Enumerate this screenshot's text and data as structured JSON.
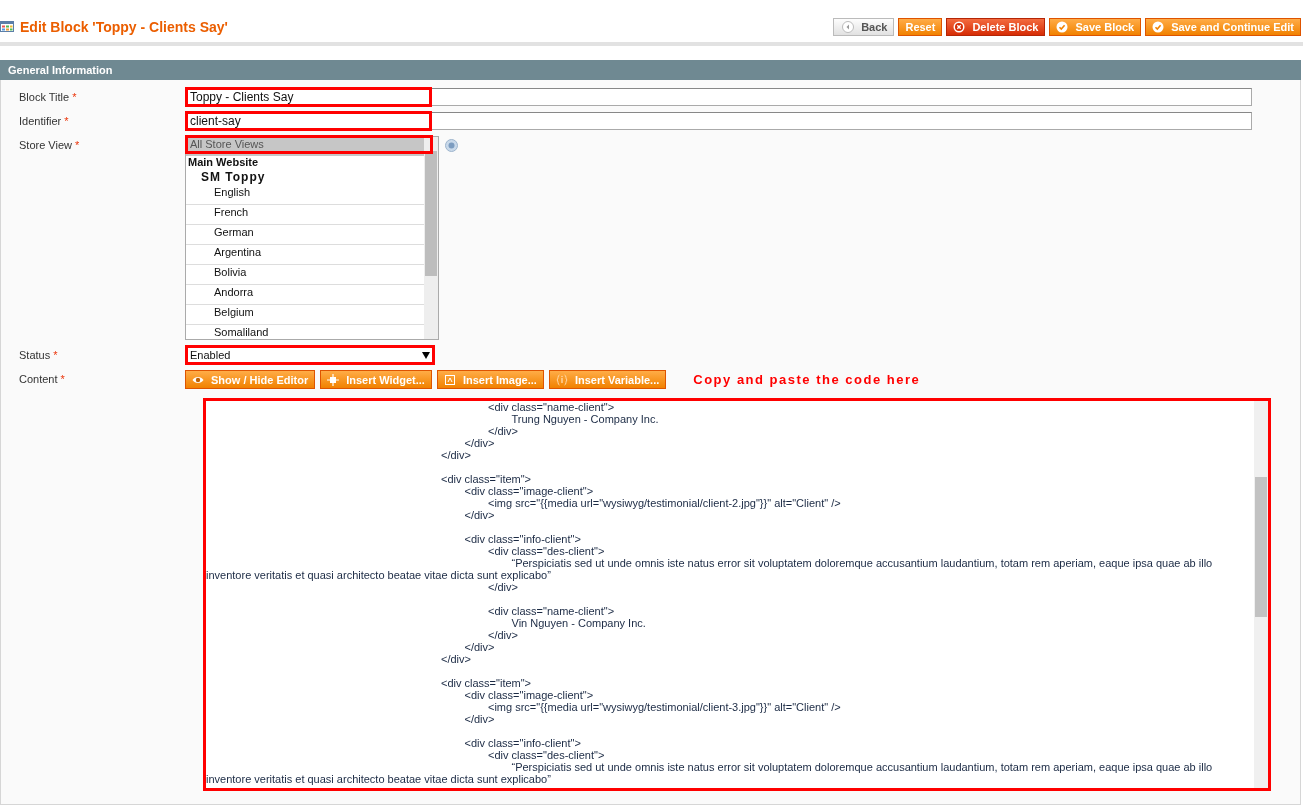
{
  "page_title": "Edit Block 'Toppy - Clients Say'",
  "buttons": [
    {
      "label": "Back",
      "kind": "back"
    },
    {
      "label": "Reset",
      "kind": "plain"
    },
    {
      "label": "Delete Block",
      "kind": "delete"
    },
    {
      "label": "Save Block",
      "kind": "save"
    },
    {
      "label": "Save and Continue Edit",
      "kind": "save"
    }
  ],
  "section": {
    "title": "General Information",
    "fields": [
      {
        "kind": "text",
        "label": "Block Title",
        "required": "*",
        "value": "Toppy - Clients Say",
        "highlighted": true
      },
      {
        "kind": "text",
        "label": "Identifier",
        "required": "*",
        "value": "client-say",
        "highlighted": true
      },
      {
        "kind": "multiselect",
        "label": "Store View",
        "required": "*",
        "highlighted": true,
        "options": [
          {
            "label": "All Store Views",
            "selected": true
          },
          {
            "group": "Main Website",
            "children": [
              {
                "group": "SM Toppy",
                "children": [
                  {
                    "label": "English",
                    "selected": false
                  },
                  {
                    "label": "French",
                    "selected": false
                  },
                  {
                    "label": "German",
                    "selected": false
                  },
                  {
                    "label": "Argentina",
                    "selected": false
                  },
                  {
                    "label": "Bolivia",
                    "selected": false
                  },
                  {
                    "label": "Andorra",
                    "selected": false
                  },
                  {
                    "label": "Belgium",
                    "selected": false
                  },
                  {
                    "label": "Somaliland",
                    "selected": false
                  }
                ]
              }
            ]
          }
        ]
      },
      {
        "kind": "select",
        "label": "Status",
        "required": "*",
        "value": "Enabled",
        "highlighted": true
      },
      {
        "kind": "editor",
        "label": "Content",
        "required": "*",
        "highlighted": true,
        "tools": [
          {
            "label": "Show / Hide Editor",
            "kind": "eye"
          },
          {
            "label": "Insert Widget...",
            "kind": "widget"
          },
          {
            "label": "Insert Image...",
            "kind": "image"
          },
          {
            "label": "Insert Variable...",
            "kind": "variable"
          }
        ],
        "note": "Copy and paste the code here",
        "value": "\t\t\t\t\t\t\t\t\t\t\t\t<div class=\"name-client\">\n\t\t\t\t\t\t\t\t\t\t\t\t\tTrung Nguyen - Company Inc.\n\t\t\t\t\t\t\t\t\t\t\t\t</div>\n\t\t\t\t\t\t\t\t\t\t\t</div>\n\t\t\t\t\t\t\t\t\t\t</div>\n\n\t\t\t\t\t\t\t\t\t\t<div class=\"item\">\n\t\t\t\t\t\t\t\t\t\t\t<div class=\"image-client\">\n\t\t\t\t\t\t\t\t\t\t\t\t<img src=\"{{media url=\"wysiwyg/testimonial/client-2.jpg\"}}\" alt=\"Client\" />\n\t\t\t\t\t\t\t\t\t\t\t</div>\n\n\t\t\t\t\t\t\t\t\t\t\t<div class=\"info-client\">\n\t\t\t\t\t\t\t\t\t\t\t\t<div class=\"des-client\">\n\t\t\t\t\t\t\t\t\t\t\t\t\t“Perspiciatis sed ut unde omnis iste natus error sit voluptatem doloremque accusantium laudantium, totam rem aperiam, eaque ipsa quae ab illo inventore veritatis et quasi architecto beatae vitae dicta sunt explicabo”\n\t\t\t\t\t\t\t\t\t\t\t\t</div>\n\n\t\t\t\t\t\t\t\t\t\t\t\t<div class=\"name-client\">\n\t\t\t\t\t\t\t\t\t\t\t\t\tVin Nguyen - Company Inc.\n\t\t\t\t\t\t\t\t\t\t\t\t</div>\n\t\t\t\t\t\t\t\t\t\t\t</div>\n\t\t\t\t\t\t\t\t\t\t</div>\n\n\t\t\t\t\t\t\t\t\t\t<div class=\"item\">\n\t\t\t\t\t\t\t\t\t\t\t<div class=\"image-client\">\n\t\t\t\t\t\t\t\t\t\t\t\t<img src=\"{{media url=\"wysiwyg/testimonial/client-3.jpg\"}}\" alt=\"Client\" />\n\t\t\t\t\t\t\t\t\t\t\t</div>\n\n\t\t\t\t\t\t\t\t\t\t\t<div class=\"info-client\">\n\t\t\t\t\t\t\t\t\t\t\t\t<div class=\"des-client\">\n\t\t\t\t\t\t\t\t\t\t\t\t\t“Perspiciatis sed ut unde omnis iste natus error sit voluptatem doloremque accusantium laudantium, totam rem aperiam, eaque ipsa quae ab illo inventore veritatis et quasi architecto beatae vitae dicta sunt explicabo”"
      }
    ]
  }
}
